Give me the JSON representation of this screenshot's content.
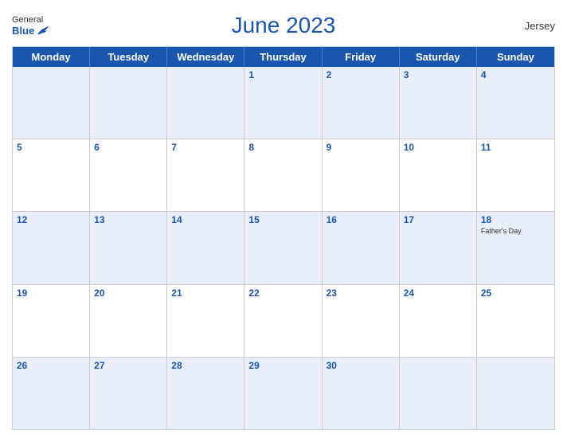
{
  "header": {
    "title": "June 2023",
    "region": "Jersey",
    "logo": {
      "general": "General",
      "blue": "Blue"
    }
  },
  "days_of_week": [
    "Monday",
    "Tuesday",
    "Wednesday",
    "Thursday",
    "Friday",
    "Saturday",
    "Sunday"
  ],
  "weeks": [
    [
      {
        "day": "",
        "holiday": ""
      },
      {
        "day": "",
        "holiday": ""
      },
      {
        "day": "",
        "holiday": ""
      },
      {
        "day": "1",
        "holiday": ""
      },
      {
        "day": "2",
        "holiday": ""
      },
      {
        "day": "3",
        "holiday": ""
      },
      {
        "day": "4",
        "holiday": ""
      }
    ],
    [
      {
        "day": "5",
        "holiday": ""
      },
      {
        "day": "6",
        "holiday": ""
      },
      {
        "day": "7",
        "holiday": ""
      },
      {
        "day": "8",
        "holiday": ""
      },
      {
        "day": "9",
        "holiday": ""
      },
      {
        "day": "10",
        "holiday": ""
      },
      {
        "day": "11",
        "holiday": ""
      }
    ],
    [
      {
        "day": "12",
        "holiday": ""
      },
      {
        "day": "13",
        "holiday": ""
      },
      {
        "day": "14",
        "holiday": ""
      },
      {
        "day": "15",
        "holiday": ""
      },
      {
        "day": "16",
        "holiday": ""
      },
      {
        "day": "17",
        "holiday": ""
      },
      {
        "day": "18",
        "holiday": "Father's Day"
      }
    ],
    [
      {
        "day": "19",
        "holiday": ""
      },
      {
        "day": "20",
        "holiday": ""
      },
      {
        "day": "21",
        "holiday": ""
      },
      {
        "day": "22",
        "holiday": ""
      },
      {
        "day": "23",
        "holiday": ""
      },
      {
        "day": "24",
        "holiday": ""
      },
      {
        "day": "25",
        "holiday": ""
      }
    ],
    [
      {
        "day": "26",
        "holiday": ""
      },
      {
        "day": "27",
        "holiday": ""
      },
      {
        "day": "28",
        "holiday": ""
      },
      {
        "day": "29",
        "holiday": ""
      },
      {
        "day": "30",
        "holiday": ""
      },
      {
        "day": "",
        "holiday": ""
      },
      {
        "day": "",
        "holiday": ""
      }
    ]
  ]
}
